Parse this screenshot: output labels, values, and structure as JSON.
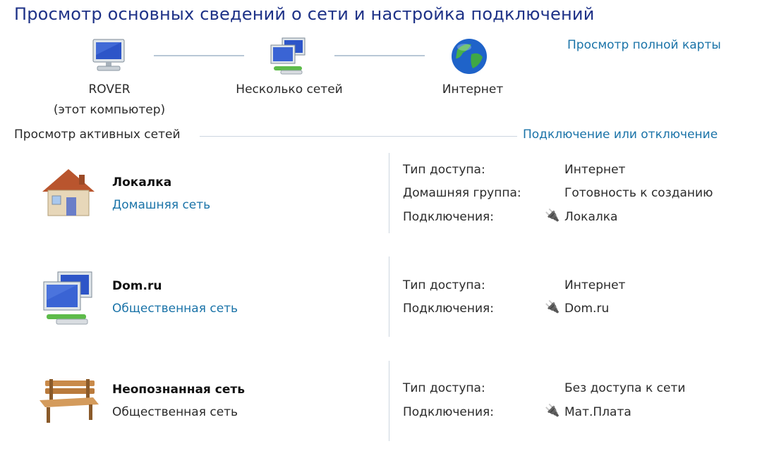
{
  "header": {
    "title": "Просмотр основных сведений о сети и настройка подключений",
    "full_map_link": "Просмотр полной карты"
  },
  "map": {
    "computer": {
      "name": "ROVER",
      "subtitle": "(этот компьютер)",
      "icon": "computer-icon"
    },
    "network": {
      "name": "Несколько сетей",
      "icon": "multiple-networks-icon"
    },
    "internet": {
      "name": "Интернет",
      "icon": "globe-icon"
    }
  },
  "active": {
    "title": "Просмотр активных сетей",
    "connect_link": "Подключение или отключение"
  },
  "networks": [
    {
      "name": "Локалка",
      "type": "Домашняя сеть",
      "type_is_link": true,
      "icon": "home-icon",
      "access_label": "Тип доступа:",
      "access_value": "Интернет",
      "homegroup_label": "Домашняя группа:",
      "homegroup_value": "Готовность к созданию",
      "conn_label": "Подключения:",
      "conn_value": "Локалка"
    },
    {
      "name": "Dom.ru",
      "type": "Общественная сеть",
      "type_is_link": true,
      "icon": "public-network-icon",
      "access_label": "Тип доступа:",
      "access_value": "Интернет",
      "conn_label": "Подключения:",
      "conn_value": "Dom.ru"
    },
    {
      "name": "Неопознанная сеть",
      "type": "Общественная сеть",
      "type_is_link": false,
      "icon": "bench-icon",
      "access_label": "Тип доступа:",
      "access_value": "Без доступа к сети",
      "conn_label": "Подключения:",
      "conn_value": "Мат.Плата"
    }
  ],
  "plug_glyph": "🔌"
}
